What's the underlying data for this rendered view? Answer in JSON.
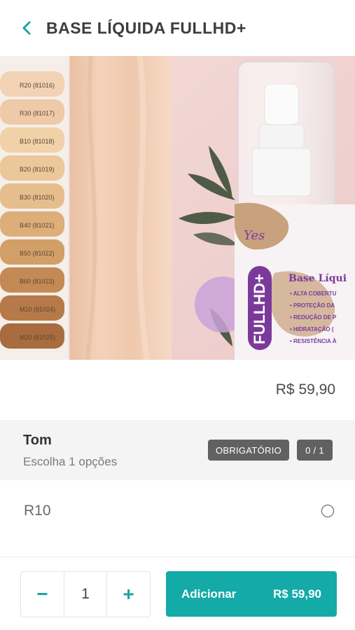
{
  "header": {
    "title": "BASE LÍQUIDA FULLHD+"
  },
  "product": {
    "price": "R$ 59,90",
    "image": {
      "shades": [
        "R20",
        "R30",
        "B10",
        "B20",
        "B30",
        "B40",
        "B50",
        "B60",
        "M10",
        "M20"
      ],
      "shade_codes": [
        "(81016)",
        "(81017)",
        "(81018)",
        "(81019)",
        "(81020)",
        "(81021)",
        "(81022)",
        "(81023)",
        "(81024)",
        "(81025)"
      ],
      "brand_mark": "Yes",
      "bottle_title": "Base Líqui",
      "bottle_logo": "FULLHD+",
      "bottle_features": [
        "• ALTA COBERTU",
        "• PROTEÇÃO DA",
        "• REDUÇÃO DE P",
        "• HIDRATAÇÃO (",
        "• RESISTÊNCIA À"
      ]
    }
  },
  "options_group": {
    "title": "Tom",
    "subtitle": "Escolha 1 opções",
    "required_badge": "OBRIGATÓRIO",
    "count_badge": "0 / 1",
    "items": [
      {
        "label": "R10"
      }
    ]
  },
  "footer": {
    "decrement": "−",
    "quantity": "1",
    "increment": "+",
    "add_label": "Adicionar",
    "add_price": "R$ 59,90"
  },
  "colors": {
    "accent": "#14aaa8",
    "badge": "#616161"
  }
}
